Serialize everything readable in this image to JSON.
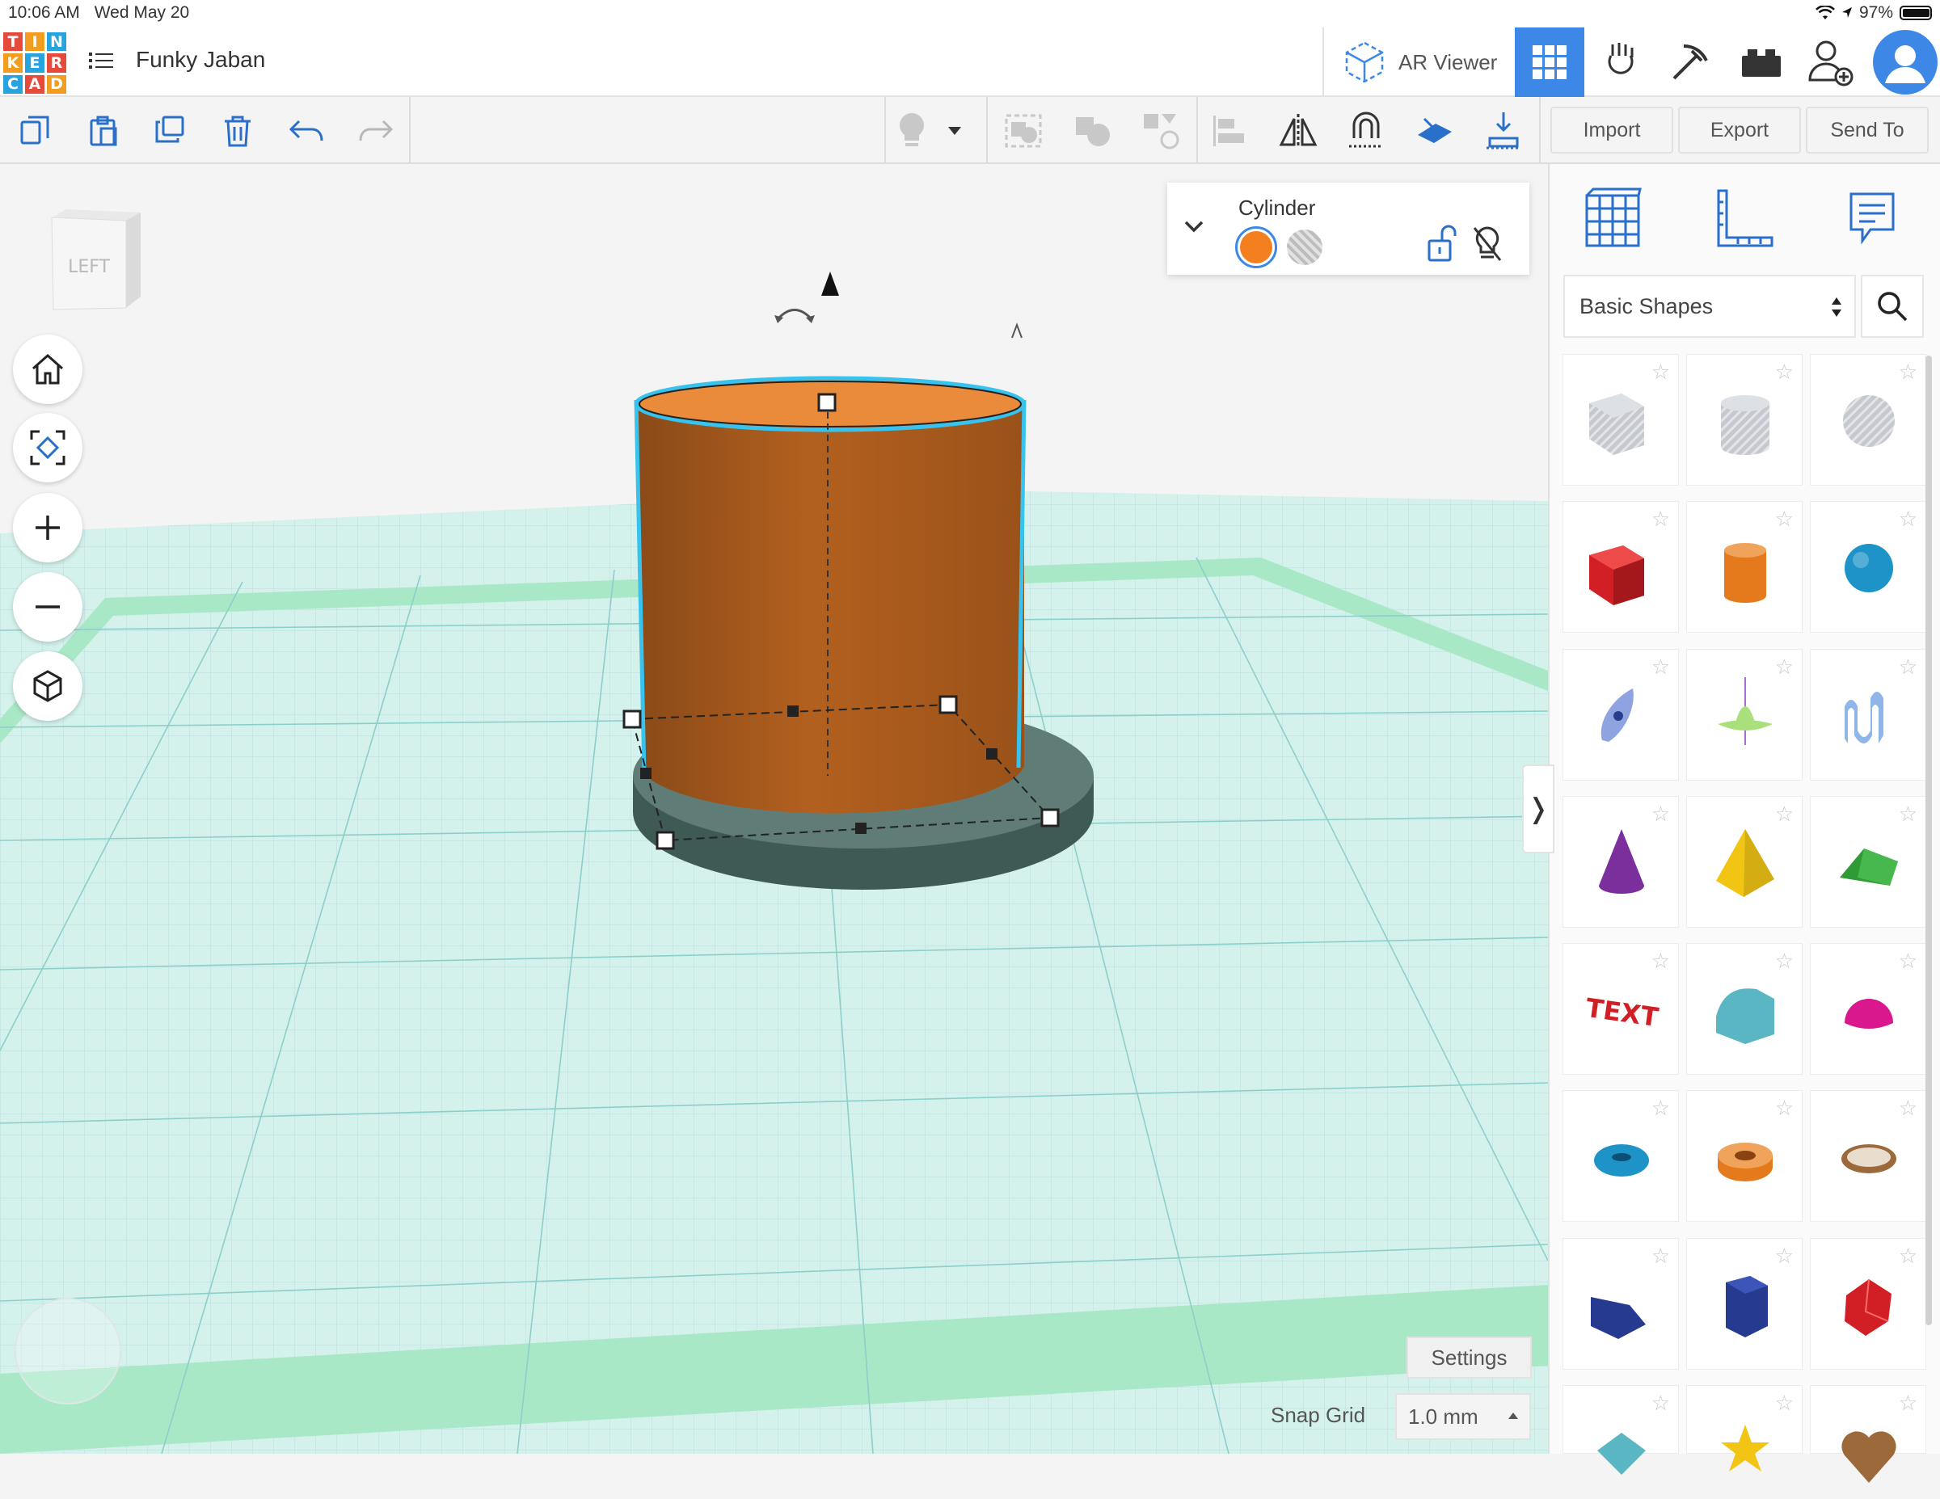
{
  "status_bar": {
    "time": "10:06 AM",
    "date": "Wed May 20",
    "battery": "97%",
    "battery_level": 0.97
  },
  "logo": {
    "letters": [
      "T",
      "I",
      "N",
      "K",
      "E",
      "R",
      "C",
      "A",
      "D"
    ],
    "colors": [
      "#e64a3b",
      "#f29d1f",
      "#27a3dd",
      "#f29d1f",
      "#27a3dd",
      "#e64a3b",
      "#27a3dd",
      "#e64a3b",
      "#f29d1f"
    ]
  },
  "header": {
    "project_title": "Funky Jaban",
    "ar_viewer_label": "AR Viewer"
  },
  "toolbar": {
    "import_label": "Import",
    "export_label": "Export",
    "send_to_label": "Send To"
  },
  "viewcube": {
    "face_label": "LEFT"
  },
  "inspector": {
    "shape_name": "Cylinder",
    "solid_color": "#f47f1f",
    "selected_mode": "solid"
  },
  "workplane": {
    "settings_label": "Settings",
    "snap_grid_label": "Snap Grid",
    "snap_grid_value": "1.0 mm"
  },
  "panel": {
    "category": "Basic Shapes",
    "shapes": [
      {
        "name": "box-hole",
        "color": "#b9bcc2"
      },
      {
        "name": "cylinder-hole",
        "color": "#b9bcc2"
      },
      {
        "name": "sphere-hole",
        "color": "#b9bcc2"
      },
      {
        "name": "box",
        "color": "#d21f25"
      },
      {
        "name": "cylinder",
        "color": "#e57a1c"
      },
      {
        "name": "sphere",
        "color": "#1d93c8"
      },
      {
        "name": "scribble",
        "color": "#8fa3e0"
      },
      {
        "name": "shape-generator-spinner",
        "color": "#a9e07c"
      },
      {
        "name": "wave",
        "color": "#8fb6e8"
      },
      {
        "name": "cone",
        "color": "#7b2f9c"
      },
      {
        "name": "pyramid",
        "color": "#f2c515"
      },
      {
        "name": "roof",
        "color": "#2f9a36"
      },
      {
        "name": "text",
        "color": "#d21f25"
      },
      {
        "name": "round-roof",
        "color": "#5ab6c2"
      },
      {
        "name": "half-sphere",
        "color": "#d9188e"
      },
      {
        "name": "torus",
        "color": "#1d93c8"
      },
      {
        "name": "tube",
        "color": "#e57a1c"
      },
      {
        "name": "ring",
        "color": "#9c6a3a"
      },
      {
        "name": "wedge",
        "color": "#263a8f"
      },
      {
        "name": "polygon",
        "color": "#263a8f"
      },
      {
        "name": "icosahedron",
        "color": "#d21f25"
      },
      {
        "name": "diamond",
        "color": "#5ab6c2"
      },
      {
        "name": "star",
        "color": "#f2c515"
      },
      {
        "name": "heart",
        "color": "#9c6a3a"
      }
    ]
  }
}
